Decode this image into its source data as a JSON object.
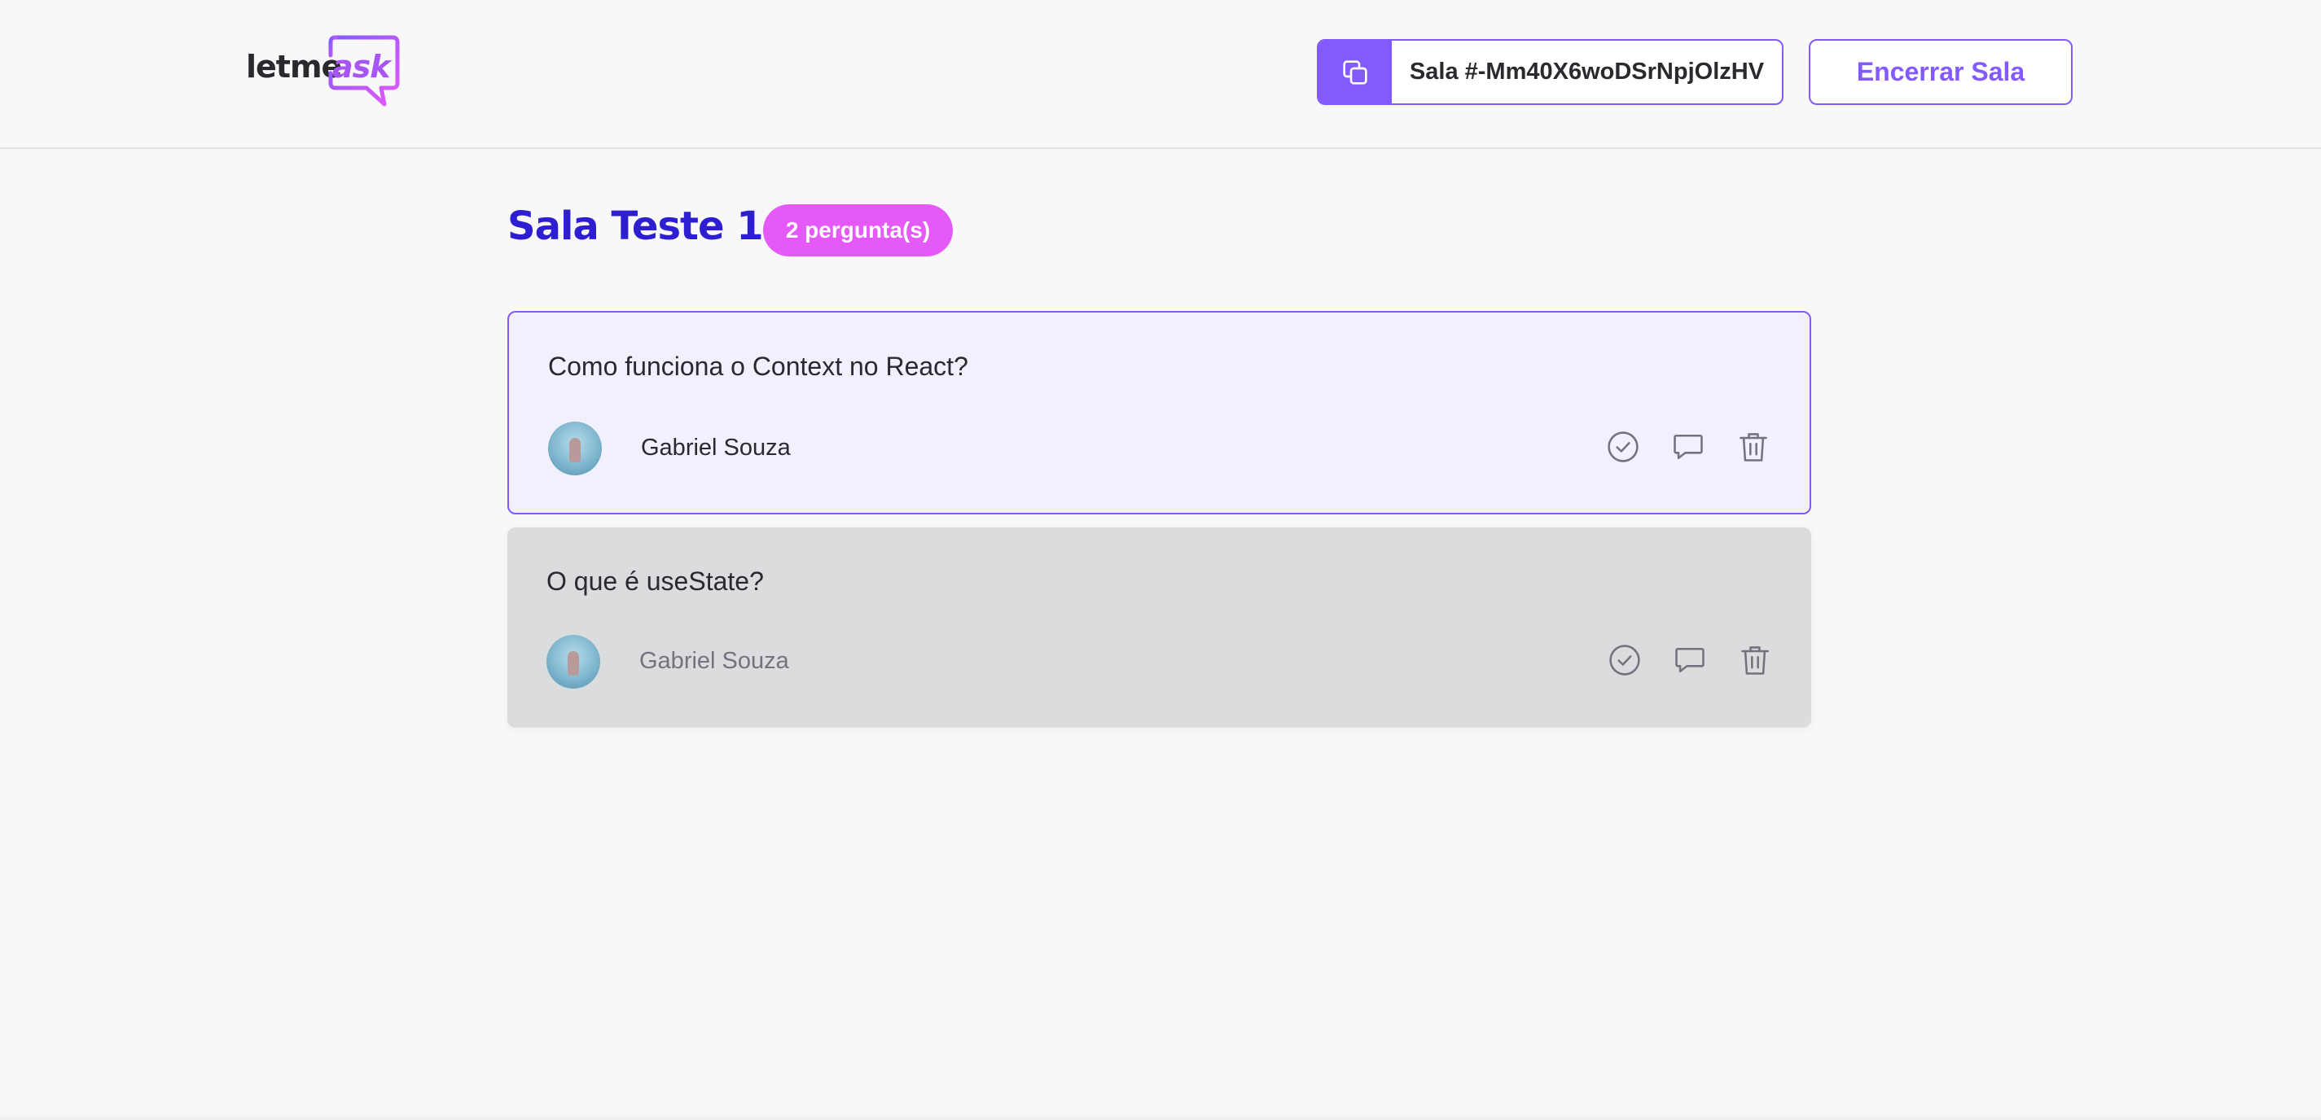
{
  "logo": {
    "letme": "letme",
    "ask": "ask"
  },
  "header": {
    "room_code_label": "Sala #-Mm40X6woDSrNpjOlzHV",
    "end_room_label": "Encerrar Sala"
  },
  "room": {
    "title": "Sala Teste 1",
    "count_badge": "2 pergunta(s)"
  },
  "questions": [
    {
      "content": "Como funciona o Context no React?",
      "author": "Gabriel Souza",
      "highlighted": true
    },
    {
      "content": "O que é useState?",
      "author": "Gabriel Souza",
      "answered": true
    }
  ],
  "colors": {
    "accent": "#835afd",
    "title": "#2d1fd1",
    "badge": "#e559f9",
    "highlight_bg": "#f2f0fd",
    "answered_bg": "#dbdcdd",
    "icon": "#737380"
  },
  "icons": [
    "copy-icon",
    "check-circle-icon",
    "answer-icon",
    "trash-icon"
  ]
}
